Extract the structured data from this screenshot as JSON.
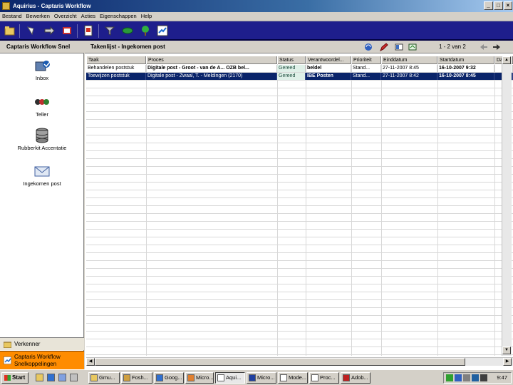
{
  "window": {
    "app": "Aquirius",
    "title": "Captaris Workflow"
  },
  "menu": [
    "Bestand",
    "Bewerken",
    "Overzicht",
    "Acties",
    "Eigenschappen",
    "Help"
  ],
  "left_pane": {
    "header": "Captaris Workflow Snel",
    "shortcuts": [
      {
        "label": "Inbox",
        "icon": "inbox-icon"
      },
      {
        "label": "Teller",
        "icon": "teller-icon"
      },
      {
        "label": "Rubberkit Accentatie",
        "icon": "database-icon"
      },
      {
        "label": "Ingekomen post",
        "icon": "envelope-icon"
      }
    ],
    "verkenner": "Verkenner",
    "snelkoppelingen_line1": "Captaris Workflow",
    "snelkoppelingen_line2": "Snelkoppelingen"
  },
  "right_pane": {
    "header": "Takenlijst - Ingekomen post",
    "page_info": "1 - 2 van 2",
    "columns": [
      "Taak",
      "Proces",
      "Status",
      "Verantwoordel...",
      "Prioriteit",
      "Einddatum",
      "Startdatum",
      "Datum"
    ],
    "rows": [
      {
        "taak": "Behandelen poststuk",
        "proces": "Digitale post - Groot - van de A... OZB bel...",
        "status": "Gereed",
        "verantwoordelijke": "beldel",
        "prioriteit": "Stand...",
        "einddatum": "27-11-2007 8:45",
        "startdatum": "16-10-2007 9:32",
        "datum": ""
      },
      {
        "taak": "Toewijzen poststuk",
        "proces": "Digitale post - Zwaal, T. - Meldingen (2170)",
        "status": "Gereed",
        "verantwoordelijke": "IBE Posten",
        "prioriteit": "Stand...",
        "einddatum": "27-11-2007 8:42",
        "startdatum": "16-10-2007 8:45",
        "datum": ""
      }
    ]
  },
  "taskbar": {
    "start": "Start",
    "tasks": [
      "Gmu...",
      "Fosh...",
      "Goog...",
      "Micro...",
      "Aqui...",
      "Micro...",
      "Mode...",
      "Proc...",
      "Adob..."
    ],
    "clock": "9:47"
  },
  "colors": {
    "title_bar": "#0a246a",
    "toolbar": "#1e1e8c",
    "selection": "#0a246a",
    "snelkoppelingen": "#ff8c00",
    "status_cell": "#dff0e8"
  }
}
